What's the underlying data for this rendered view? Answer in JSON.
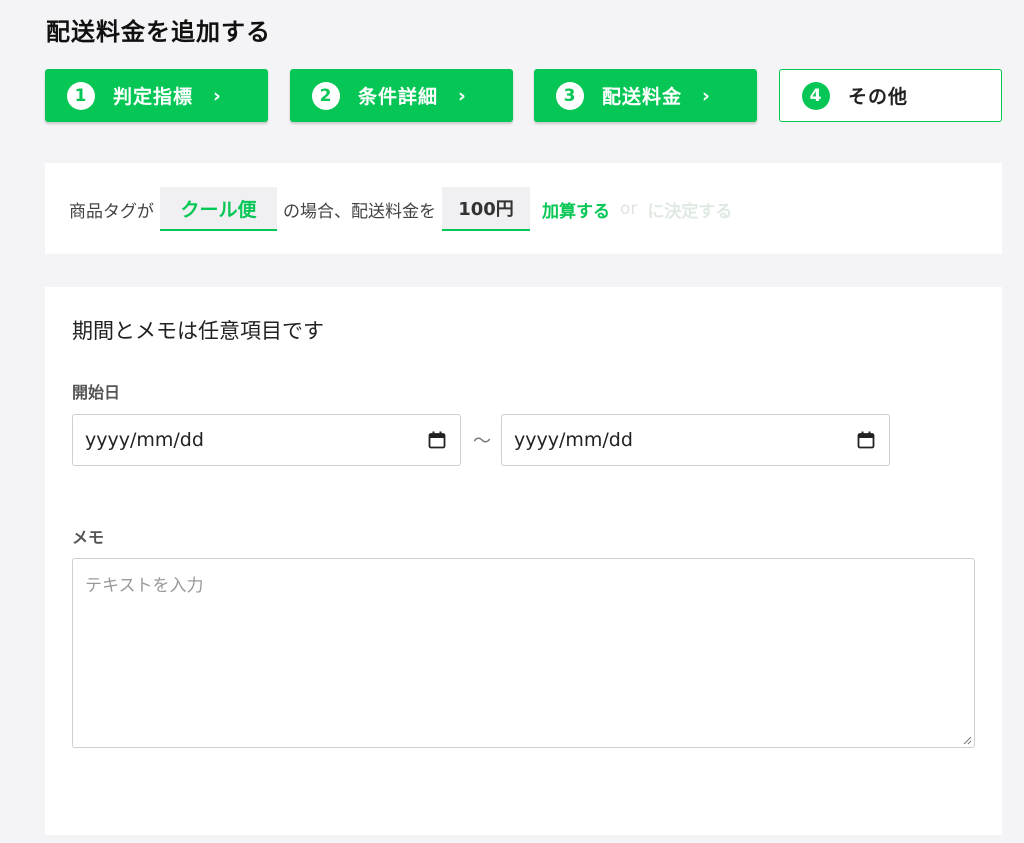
{
  "page": {
    "title": "配送料金を追加する"
  },
  "steps": [
    {
      "number": "1",
      "label": "判定指標",
      "chevron": "›",
      "state": "done"
    },
    {
      "number": "2",
      "label": "条件詳細",
      "chevron": "›",
      "state": "done"
    },
    {
      "number": "3",
      "label": "配送料金",
      "chevron": "›",
      "state": "done"
    },
    {
      "number": "4",
      "label": "その他",
      "state": "current"
    }
  ],
  "summary": {
    "prefix": "商品タグが",
    "tag_value": "クール便",
    "middle": "の場合、配送料金を",
    "price_value": "100円",
    "add_option": "加算する",
    "or_text": "or",
    "decide_option": "に決定する"
  },
  "form": {
    "title": "期間とメモは任意項目です",
    "start_label": "開始日",
    "start_date_placeholder": "yyyy/mm/dd",
    "range_separator": "〜",
    "end_date_placeholder": "yyyy/mm/dd",
    "memo_label": "メモ",
    "memo_placeholder": "テキストを入力"
  },
  "colors": {
    "accent": "#06c755",
    "background": "#f4f4f6",
    "panel": "#ffffff"
  },
  "icons": {
    "date_picker": "calendar-icon",
    "resize": "resize-handle-icon"
  }
}
